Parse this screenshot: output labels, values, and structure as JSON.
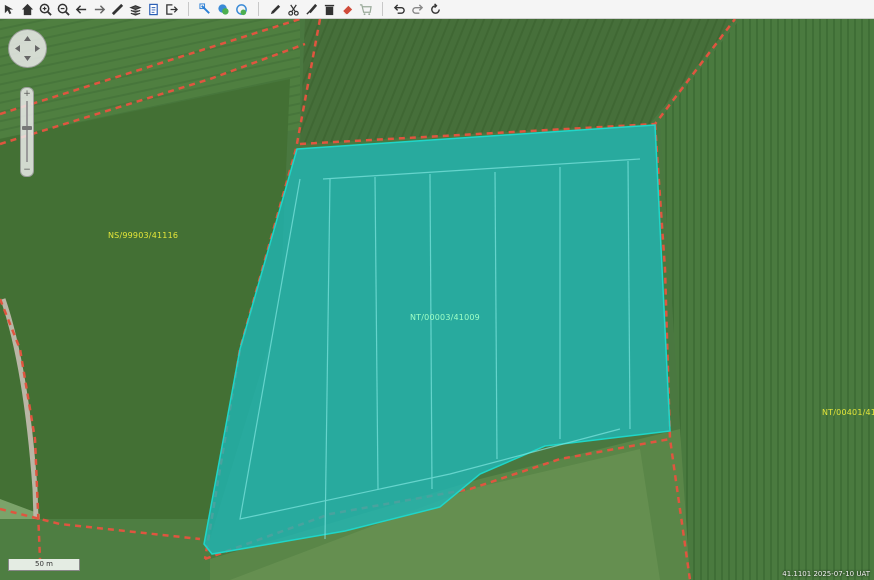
{
  "toolbar": {
    "groups": [
      [
        "cursor-icon",
        "home-icon",
        "zoom-in-icon",
        "zoom-out-icon",
        "back-arrow-icon",
        "forward-arrow-icon",
        "measure-icon",
        "layers-icon",
        "document-icon",
        "export-icon"
      ],
      [
        "select-icon",
        "identify-icon",
        "refresh-layer-icon"
      ],
      [
        "pencil-icon",
        "scissors-icon",
        "brush-icon",
        "delete-icon",
        "eraser-icon",
        "cart-icon"
      ],
      [
        "undo-icon",
        "redo-icon",
        "rotate-icon"
      ]
    ]
  },
  "map": {
    "labels": {
      "parcel_left": "NS/99903/41116",
      "parcel_selected": "NT/00003/41009",
      "parcel_right": "NT/00401/41"
    },
    "scale_label": "50 m",
    "coords_text": "41.1101  2025-07-10  UAT",
    "colors": {
      "selection_fill": "#1fb8b8",
      "boundary": "#e0553f",
      "label": "#e5e63a"
    }
  }
}
